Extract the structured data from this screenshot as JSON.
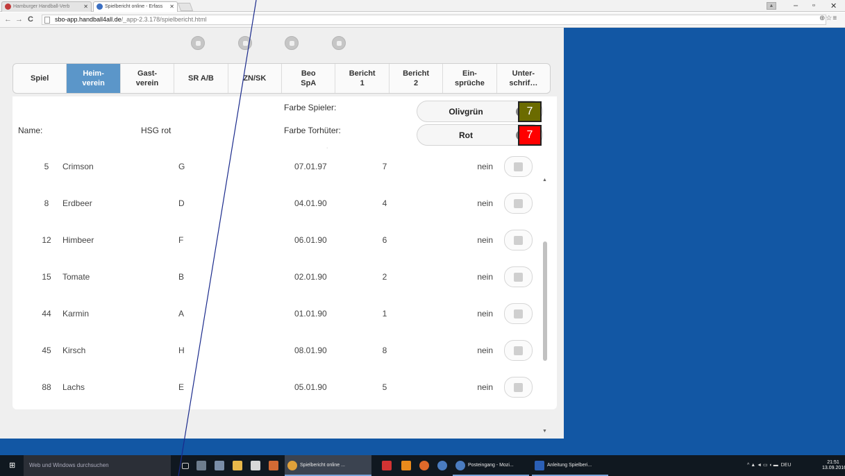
{
  "browser": {
    "tabs": [
      {
        "title": "Hamburger Handball-Verb",
        "active": false
      },
      {
        "title": "Spielbericht online - Erfass",
        "active": true
      }
    ],
    "url_host": "sbo-app.handball4all.de",
    "url_path": "/_app-2.3.178/spielbericht.html"
  },
  "toolbar_icons": [
    "grid-icon",
    "compass-icon",
    "list-icon",
    "settings-icon"
  ],
  "tabs": [
    {
      "label": "Spiel",
      "active": false
    },
    {
      "label": "Heim-\nverein",
      "active": true
    },
    {
      "label": "Gast-\nverein",
      "active": false
    },
    {
      "label": "SR A/B",
      "active": false
    },
    {
      "label": "ZN/SK",
      "active": false
    },
    {
      "label": "Beo\nSpA",
      "active": false
    },
    {
      "label": "Bericht\n1",
      "active": false
    },
    {
      "label": "Bericht\n2",
      "active": false
    },
    {
      "label": "Ein-\nsprüche",
      "active": false
    },
    {
      "label": "Unter-\nschrif…",
      "active": false
    }
  ],
  "team": {
    "name_label": "Name:",
    "name_value": "HSG rot",
    "player_color_label": "Farbe Spieler:",
    "player_color_value": "Olivgrün",
    "player_color_hex": "#6b6b00",
    "player_color_number": "7",
    "keeper_color_label": "Farbe Torhüter:",
    "keeper_color_value": "Rot",
    "keeper_color_hex": "#ff0000",
    "keeper_color_number": "7"
  },
  "players": [
    {
      "number": "5",
      "name": "Crimson",
      "letter": "G",
      "birthdate": "07.01.97",
      "count": "7",
      "status": "nein"
    },
    {
      "number": "8",
      "name": "Erdbeer",
      "letter": "D",
      "birthdate": "04.01.90",
      "count": "4",
      "status": "nein"
    },
    {
      "number": "12",
      "name": "Himbeer",
      "letter": "F",
      "birthdate": "06.01.90",
      "count": "6",
      "status": "nein"
    },
    {
      "number": "15",
      "name": "Tomate",
      "letter": "B",
      "birthdate": "02.01.90",
      "count": "2",
      "status": "nein"
    },
    {
      "number": "44",
      "name": "Karmin",
      "letter": "A",
      "birthdate": "01.01.90",
      "count": "1",
      "status": "nein"
    },
    {
      "number": "45",
      "name": "Kirsch",
      "letter": "H",
      "birthdate": "08.01.90",
      "count": "8",
      "status": "nein"
    },
    {
      "number": "88",
      "name": "Lachs",
      "letter": "E",
      "birthdate": "05.01.90",
      "count": "5",
      "status": "nein"
    }
  ],
  "taskbar": {
    "search_placeholder": "Web und Windows durchsuchen",
    "items": [
      {
        "label": "Spielbericht online ...",
        "active": true
      },
      {
        "label": "Posteingang - Mozi...",
        "active": false
      },
      {
        "label": "Anleitung Spielberi...",
        "active": false
      }
    ],
    "language": "DEU",
    "time": "21:51",
    "date": "13.09.2016"
  }
}
